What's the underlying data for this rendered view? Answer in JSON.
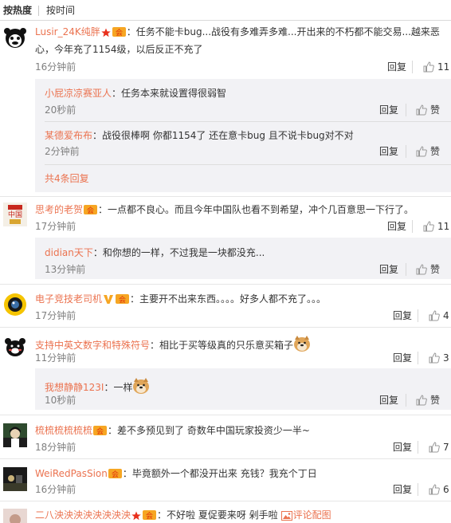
{
  "tabs": {
    "hot": "按热度",
    "time": "按时间"
  },
  "actions": {
    "reply": "回复",
    "like": "赞"
  },
  "colors": {
    "username": "#eb7350",
    "time": "#808080",
    "sub_bg": "#f2f2f5"
  },
  "comments": [
    {
      "user": "Lusir_24K纯胖",
      "text_line1": "：任务不能卡bug...战役有多难弄多难...开出来的不朽都不能交易...越来恶",
      "text_line2": "心，今年充了1154级，以后反正不充了",
      "time": "16分钟前",
      "likes": "11",
      "replies": [
        {
          "user": "小屁凉凉赛亚人",
          "text": "：任务本来就设置得很弱智",
          "time": "20秒前"
        },
        {
          "user": "某德爱布布",
          "text": "：战役很棒啊 你都1154了 还在意卡bug 且不说卡bug对不对",
          "time": "2分钟前"
        }
      ],
      "more": "共4条回复"
    },
    {
      "user": "思考的老贺",
      "avatar_text": "中国",
      "text_line1": "：一点都不良心。而且今年中国队也看不到希望，冲个几百意思一下行了。",
      "time": "17分钟前",
      "likes": "11",
      "replies": [
        {
          "user": "didian天下",
          "text": "：和你想的一样，不过我是一块都没充...",
          "time": "13分钟前"
        }
      ]
    },
    {
      "user": "电子竞技老司机",
      "text_line1": "：主要开不出来东西。。。。好多人都不充了。。。",
      "time": "17分钟前",
      "likes": "4"
    },
    {
      "user": "支持中英文数字和特殊符号",
      "text_line1": "：相比于买等级真的只乐意买箱子",
      "time": "11分钟前",
      "likes": "3",
      "replies": [
        {
          "user": "我想静静123I",
          "text": "：一样",
          "time": "10秒前"
        }
      ]
    },
    {
      "user": "梳梳梳梳梳梳",
      "text_line1": "：差不多预见到了 奇数年中国玩家投资少一半~",
      "time": "18分钟前",
      "likes": "7"
    },
    {
      "user": "WeiRedPasSion",
      "text_line1": "：毕竟额外一个都没开出来 充钱？我充个丁日",
      "time": "16分钟前",
      "likes": "6"
    },
    {
      "user": "二八泱泱泱泱泱泱泱泱",
      "text_line1": "：不好啦 夏促要来呀 剁手啦",
      "link": "评论配图"
    }
  ]
}
